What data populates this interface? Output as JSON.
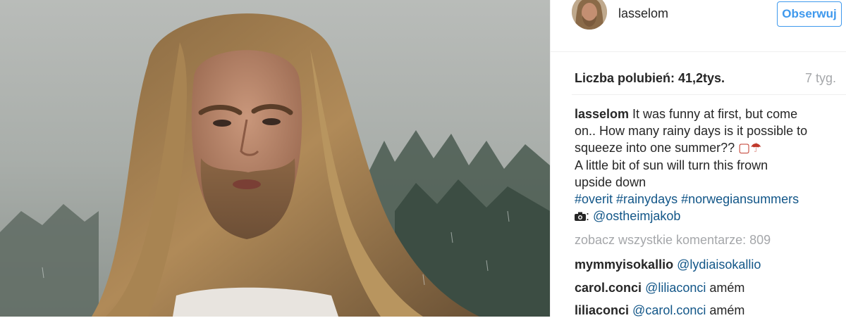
{
  "post": {
    "username": "lasselom",
    "follow_label": "Obserwuj",
    "likes_text": "Liczba polubień: 41,2tys.",
    "age_text": "7 tyg.",
    "caption": {
      "user": "lasselom",
      "line1": " It was funny at first, but come",
      "line2": "on.. How many rainy days is it possible to",
      "line3": "squeeze into one summer?? ",
      "line3_emoji": "▢☂",
      "line4": "A little bit of sun will turn this frown",
      "line5": "upside down",
      "hashtags": [
        "#overit",
        "#rainydays",
        "#norwegiansummers"
      ],
      "credit_sep": ": ",
      "credit_link": "@ostheimjakob"
    },
    "view_all_comments": "zobacz wszystkie komentarze: 809",
    "comments": [
      {
        "user": "mymmyisokallio",
        "mention": "@lydiaisokallio",
        "text": ""
      },
      {
        "user": "carol.conci",
        "mention": "@liliaconci",
        "text": " amém"
      },
      {
        "user": "liliaconci",
        "mention": "@carol.conci",
        "text": " amém"
      }
    ]
  },
  "icons": {
    "camera": "camera-icon",
    "umbrella": "umbrella-icon"
  },
  "colors": {
    "link": "#125688",
    "follow": "#3f99ed",
    "muted": "#a5a7aa",
    "text": "#262626"
  }
}
